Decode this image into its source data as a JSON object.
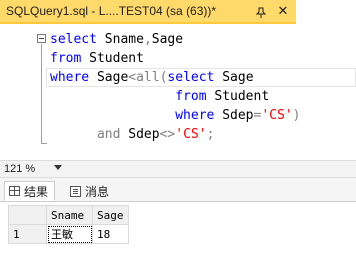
{
  "document_tab": {
    "title": "SQLQuery1.sql - L....TEST04 (sa (63))*",
    "pin_icon": "pin-icon",
    "close_glyph": "✕"
  },
  "editor": {
    "colors": {
      "keyword": "#0000ff",
      "operator": "#808080",
      "function": "#ff00ff",
      "string": "#ff0000",
      "identifier": "#000000"
    },
    "lines": [
      [
        {
          "t": "select",
          "c": "kw"
        },
        {
          "t": " Sname",
          "c": "id"
        },
        {
          "t": ",",
          "c": "op"
        },
        {
          "t": "Sage",
          "c": "id"
        }
      ],
      [
        {
          "t": "from",
          "c": "kw"
        },
        {
          "t": " Student",
          "c": "id"
        }
      ],
      [
        {
          "t": "where",
          "c": "kw"
        },
        {
          "t": " Sage",
          "c": "id"
        },
        {
          "t": "<",
          "c": "op"
        },
        {
          "t": "all",
          "c": "op"
        },
        {
          "t": "(",
          "c": "op"
        },
        {
          "t": "select",
          "c": "kw"
        },
        {
          "t": " Sage",
          "c": "id"
        }
      ],
      [
        {
          "t": "                ",
          "c": "id"
        },
        {
          "t": "from",
          "c": "kw"
        },
        {
          "t": " Student",
          "c": "id"
        }
      ],
      [
        {
          "t": "                ",
          "c": "id"
        },
        {
          "t": "where",
          "c": "kw"
        },
        {
          "t": " Sdep",
          "c": "id"
        },
        {
          "t": "=",
          "c": "op"
        },
        {
          "t": "'CS'",
          "c": "str"
        },
        {
          "t": ")",
          "c": "op"
        }
      ],
      [
        {
          "t": "      ",
          "c": "id"
        },
        {
          "t": "and",
          "c": "op"
        },
        {
          "t": " Sdep",
          "c": "id"
        },
        {
          "t": "<>",
          "c": "op"
        },
        {
          "t": "'CS'",
          "c": "str"
        },
        {
          "t": ";",
          "c": "op"
        }
      ]
    ]
  },
  "zoom": {
    "value": "121 %"
  },
  "result_tabs": [
    {
      "label": "结果",
      "icon": "grid-icon",
      "active": true
    },
    {
      "label": "消息",
      "icon": "message-icon",
      "active": false
    }
  ],
  "results": {
    "columns": [
      "Sname",
      "Sage"
    ],
    "rows": [
      {
        "row_number": "1",
        "cells": [
          "王敏",
          "18"
        ]
      }
    ]
  }
}
